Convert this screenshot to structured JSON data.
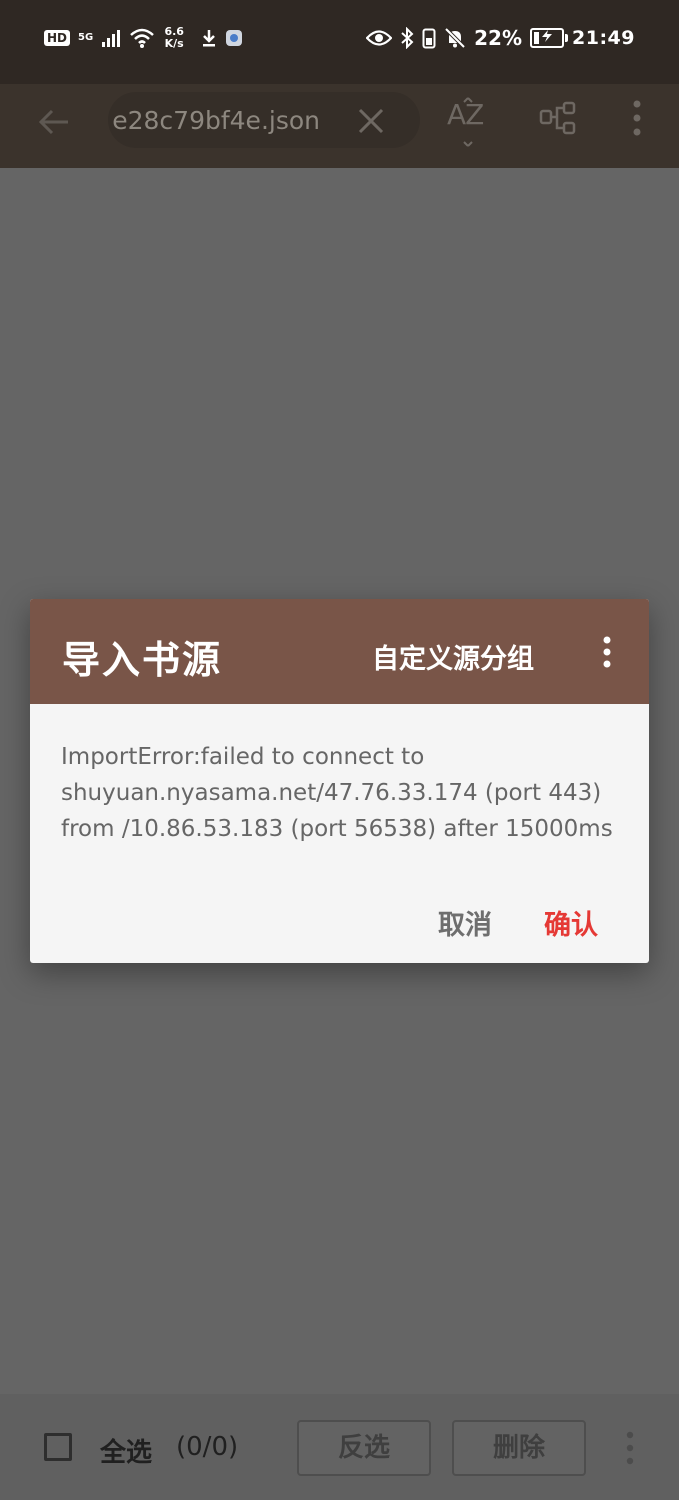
{
  "status_bar": {
    "hd": "HD",
    "network": "5G",
    "speed_value": "6.6",
    "speed_unit": "K/s",
    "battery_percent": "22%",
    "battery_level": 0.22,
    "time": "21:49"
  },
  "toolbar": {
    "search_text": "e28c79bf4e.json",
    "sort_label": "AZ"
  },
  "dialog": {
    "title": "导入书源",
    "custom_group": "自定义源分组",
    "message": "ImportError:failed to connect to shuyuan.nyasama.net/47.76.33.174 (port 443) from /10.86.53.183 (port 56538) after 15000ms",
    "cancel": "取消",
    "confirm": "确认"
  },
  "bottom_bar": {
    "select_all": "全选",
    "selected_count": "(0/0)",
    "invert": "反选",
    "delete": "删除"
  },
  "colors": {
    "dialog_header": "#795548",
    "confirm": "#e53935",
    "overlay": "#656565"
  }
}
